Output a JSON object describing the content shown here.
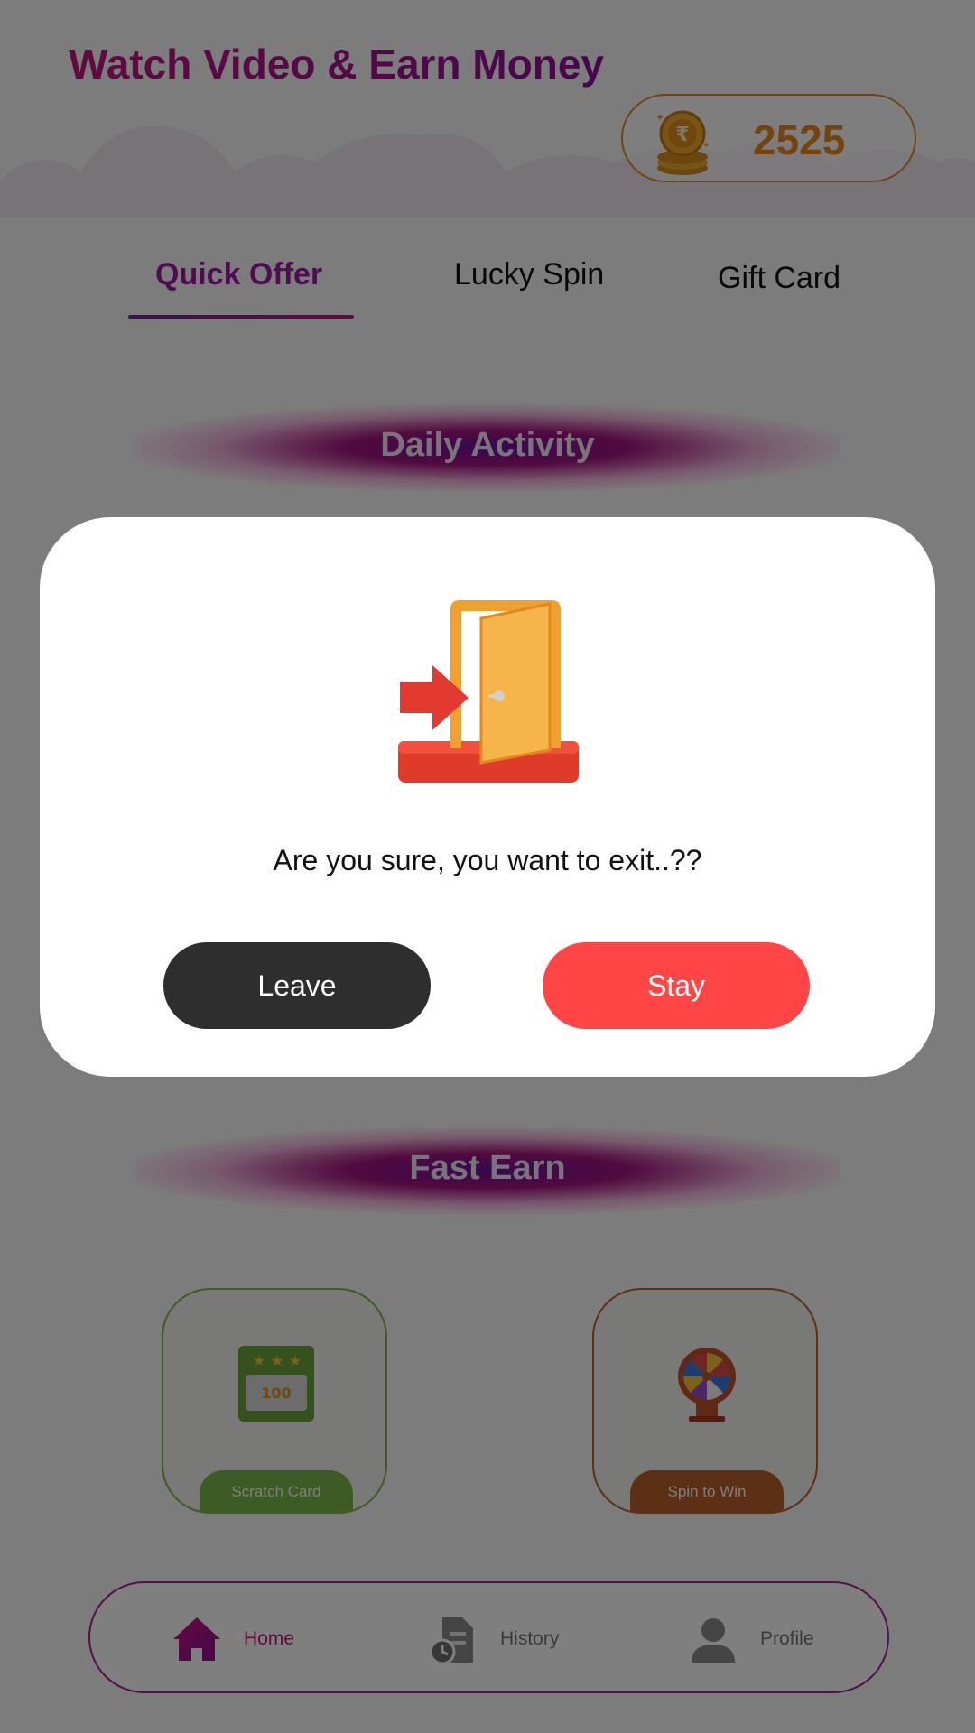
{
  "header": {
    "title": "Watch Video & Earn Money",
    "coin_balance": "2525"
  },
  "tabs": [
    {
      "label": "Quick Offer",
      "active": true
    },
    {
      "label": "Lucky Spin",
      "active": false
    },
    {
      "label": "Gift Card",
      "active": false
    }
  ],
  "sections": {
    "daily": "Daily Activity",
    "fast": "Fast Earn"
  },
  "cards": [
    {
      "label": "Scratch Card",
      "badge": "100",
      "icon": "scratch-card-icon"
    },
    {
      "label": "Spin to Win",
      "icon": "spin-wheel-icon"
    }
  ],
  "bottom_nav": [
    {
      "label": "Home",
      "icon": "home-icon",
      "active": true
    },
    {
      "label": "History",
      "icon": "history-icon",
      "active": false
    },
    {
      "label": "Profile",
      "icon": "profile-icon",
      "active": false
    }
  ],
  "dialog": {
    "icon": "exit-door-icon",
    "message": "Are you sure, you want to exit..??",
    "leave_label": "Leave",
    "stay_label": "Stay"
  },
  "colors": {
    "accent": "#b0148a",
    "stay": "#ff4545",
    "leave": "#2e2e2e",
    "coin": "#e8891f"
  }
}
